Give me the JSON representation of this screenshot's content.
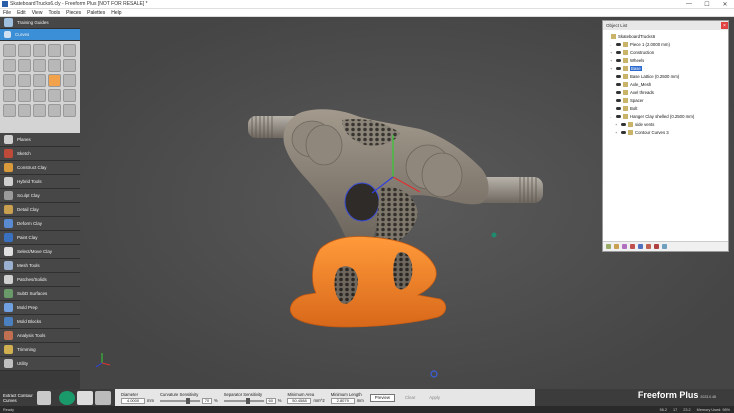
{
  "window": {
    "title": "SkateboardTrucks6.cly - Freeform Plus [NOT FOR RESALE] *"
  },
  "menu": [
    "File",
    "Edit",
    "View",
    "Tools",
    "Pieces",
    "Palettes",
    "Help"
  ],
  "left_panel": {
    "top_items": [
      {
        "label": "Training Guides"
      }
    ],
    "active": {
      "label": "Curves"
    },
    "tools_below": [
      {
        "label": "Planes",
        "icon": "plane-icon",
        "color": "#cfcfcf"
      },
      {
        "label": "Sketch",
        "icon": "sketch-icon",
        "color": "#c04a3a"
      },
      {
        "label": "Construct Clay",
        "icon": "construct-clay-icon",
        "color": "#d89a3a"
      },
      {
        "label": "Hybrid Tools",
        "icon": "hybrid-tools-icon",
        "color": "#cfcfcf"
      },
      {
        "label": "Sculpt Clay",
        "icon": "sculpt-clay-icon",
        "color": "#9a9a9a"
      },
      {
        "label": "Detail Clay",
        "icon": "detail-clay-icon",
        "color": "#c8a050"
      },
      {
        "label": "Deform Clay",
        "icon": "deform-clay-icon",
        "color": "#5a8ad0"
      },
      {
        "label": "Paint Clay",
        "icon": "paint-clay-icon",
        "color": "#3a70c0"
      },
      {
        "label": "Select/Move Clay",
        "icon": "select-move-icon",
        "color": "#e0e0e0"
      },
      {
        "label": "Mesh Tools",
        "icon": "mesh-tools-icon",
        "color": "#9ab0d0"
      },
      {
        "label": "Patches/Solids",
        "icon": "patches-icon",
        "color": "#d0d0d0"
      },
      {
        "label": "SubD Surfaces",
        "icon": "subd-icon",
        "color": "#6a9a6a"
      },
      {
        "label": "Mold Prep",
        "icon": "mold-prep-icon",
        "color": "#70a0e0"
      },
      {
        "label": "Mold Blocks",
        "icon": "mold-blocks-icon",
        "color": "#4a80c0"
      },
      {
        "label": "Analysis Tools",
        "icon": "analysis-icon",
        "color": "#c07050"
      },
      {
        "label": "Trimming",
        "icon": "trimming-icon",
        "color": "#d0b050"
      },
      {
        "label": "Utility",
        "icon": "utility-icon",
        "color": "#c0c0c0"
      }
    ]
  },
  "object_list": {
    "title": "Object List",
    "items": [
      {
        "label": "SkateboardTrucks6",
        "indent": 0,
        "expander": ""
      },
      {
        "label": "Piece 1 (2.0000 mm)",
        "indent": 1,
        "expander": "-"
      },
      {
        "label": "Construction",
        "indent": 1,
        "expander": "+"
      },
      {
        "label": "Wheels",
        "indent": 1,
        "expander": "+"
      },
      {
        "label": "Base",
        "indent": 1,
        "expander": "+",
        "selected": true
      },
      {
        "label": "Base Lattice (0.2500 mm)",
        "indent": 1,
        "expander": ""
      },
      {
        "label": "Axle_Mesh",
        "indent": 1,
        "expander": ""
      },
      {
        "label": "Axel threads",
        "indent": 1,
        "expander": ""
      },
      {
        "label": "Spacer",
        "indent": 1,
        "expander": ""
      },
      {
        "label": "Bolt",
        "indent": 1,
        "expander": ""
      },
      {
        "label": "Hanger Clay shelled (0.2500 mm)",
        "indent": 1,
        "expander": "-"
      },
      {
        "label": "side vents",
        "indent": 2,
        "expander": "+"
      },
      {
        "label": "Contour Curves 3",
        "indent": 2,
        "expander": "+"
      }
    ]
  },
  "bottom": {
    "tool_name": "Extract Contour Curves",
    "diameter_label": "Diameter",
    "diameter_value": "4.0000",
    "diameter_unit": "mm",
    "curvature_label": "Curvature Sensitivity",
    "curvature_value": "70",
    "curvature_unit": "%",
    "curvature_level": 0.7,
    "separator_label": "Separator Sensitivity",
    "separator_value": "60",
    "separator_unit": "%",
    "separator_level": 0.6,
    "min_area_label": "Minimum Area",
    "min_area_value": "50.4588",
    "min_area_unit": "mm^2",
    "min_length_label": "Minimum Length",
    "min_length_value": "2.8079",
    "min_length_unit": "mm",
    "preview": "Preview",
    "clear": "Clear",
    "apply": "Apply",
    "brand": "Freeform Plus",
    "brand_version": "2023.0.48"
  },
  "status": {
    "left": "Ready",
    "coords": [
      "56.2",
      "17",
      "23.2"
    ],
    "memory": "Memory Used: 98%"
  },
  "colors": {
    "accent": "#3a8fd6",
    "model_grey": "#8a8378",
    "model_orange": "#f08a2a"
  }
}
